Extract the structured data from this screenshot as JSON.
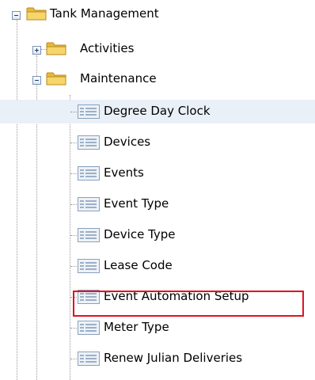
{
  "tree": {
    "root": {
      "label": "Tank Management",
      "expanded": true
    },
    "activities": {
      "label": "Activities",
      "expanded": false
    },
    "maintenance": {
      "label": "Maintenance",
      "expanded": true
    },
    "screens": [
      {
        "label": "Degree Day Clock",
        "hovered": true
      },
      {
        "label": "Devices"
      },
      {
        "label": "Events"
      },
      {
        "label": "Event Type"
      },
      {
        "label": "Device Type"
      },
      {
        "label": "Lease Code"
      },
      {
        "label": "Event Automation Setup",
        "highlighted": true
      },
      {
        "label": "Meter Type"
      },
      {
        "label": "Renew Julian Deliveries"
      }
    ]
  },
  "colors": {
    "folder": "#f2c94c",
    "hover_row": "#eaf0f8",
    "highlight_border": "#e0141e"
  },
  "icons": {
    "folder": "folder-icon",
    "screen": "screen-icon",
    "expand": "expand-icon",
    "collapse": "collapse-icon"
  }
}
